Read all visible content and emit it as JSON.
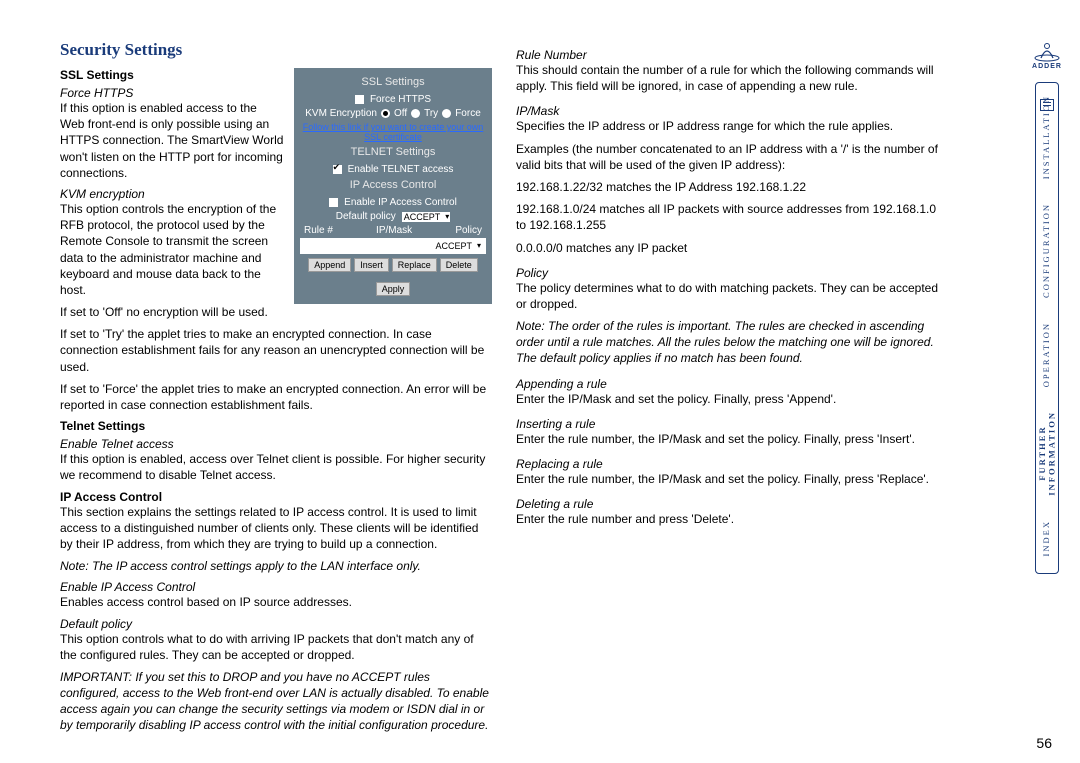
{
  "title": "Security Settings",
  "pagenum": "56",
  "left": {
    "ssl_heading": "SSL Settings",
    "force_https_h": "Force HTTPS",
    "force_https_body": "If this option is enabled access to the Web front-end is only possible using an HTTPS connection. The SmartView World won't listen on the HTTP port for incoming connections.",
    "kvm_h": "KVM encryption",
    "kvm_body1": "This option controls the encryption of the RFB protocol, the protocol used by the Remote Console to transmit the screen data to the administrator machine and keyboard and mouse data back to the host.",
    "kvm_body2": "If set to 'Off' no encryption will be used.",
    "kvm_body3": "If set to 'Try' the applet tries to make an encrypted connection. In case connection establishment fails for any reason an unencrypted connection will be used.",
    "kvm_body4": "If set to 'Force' the applet tries to make an encrypted connection. An error will be reported in case connection establishment fails.",
    "telnet_heading": "Telnet Settings",
    "telnet_h": "Enable Telnet access",
    "telnet_body": "If this option is enabled, access over Telnet client is possible. For higher security we recommend to disable Telnet access.",
    "ipac_heading": "IP Access Control",
    "ipac_body": "This section explains the settings related to IP access control. It is used to limit access to a distinguished number of clients only. These clients will be identified by their IP address, from which they are trying to build up a connection.",
    "ipac_note": "Note: The IP access control settings apply to the LAN interface only.",
    "enable_ipac_h": "Enable IP Access Control",
    "enable_ipac_body": "Enables access control based on IP source addresses.",
    "defpol_h": "Default policy",
    "defpol_body": "This option controls what to do with arriving IP packets that don't match any of the configured rules. They can be accepted or dropped.",
    "defpol_note": "IMPORTANT: If you set this to DROP and you have no ACCEPT rules configured, access to the Web front-end over LAN is actually disabled. To enable access again you can change the security settings via modem or ISDN dial in or by temporarily disabling IP access control with the initial configuration procedure."
  },
  "right": {
    "rule_h": "Rule Number",
    "rule_body": "This should contain the number of a rule for which the following commands will apply. This field will be ignored, in case of appending a new rule.",
    "ipmask_h": "IP/Mask",
    "ipmask_body": "Specifies the IP address or IP address range for which the rule applies.",
    "ipmask_ex_intro": "Examples (the number concatenated to an IP address with a '/' is the number of valid bits that will be used of the given IP address):",
    "ipmask_ex1": "192.168.1.22/32 matches the IP Address 192.168.1.22",
    "ipmask_ex2": "192.168.1.0/24 matches all IP packets with source addresses from 192.168.1.0 to 192.168.1.255",
    "ipmask_ex3": "0.0.0.0/0 matches any IP packet",
    "policy_h": "Policy",
    "policy_body": "The policy determines what to do with matching packets. They can be accepted or dropped.",
    "policy_note": "Note: The order of the rules is important. The rules are checked in ascending order until a rule matches. All the rules below the matching one will be ignored. The default policy applies if no match has been found.",
    "append_h": "Appending a rule",
    "append_body": "Enter the IP/Mask and set the policy. Finally, press 'Append'.",
    "insert_h": "Inserting a rule",
    "insert_body": "Enter the rule number, the IP/Mask and set the policy. Finally, press 'Insert'.",
    "replace_h": "Replacing a rule",
    "replace_body": "Enter the rule number, the IP/Mask and set the policy. Finally, press 'Replace'.",
    "delete_h": "Deleting a rule",
    "delete_body": "Enter the rule number and press 'Delete'."
  },
  "panel": {
    "ssl_title": "SSL Settings",
    "force_https": "Force HTTPS",
    "kvm_label": "KVM Encryption",
    "off": "Off",
    "try": "Try",
    "force": "Force",
    "ssl_link": "Follow this link if you want to create your own SSL certificate",
    "telnet_title": "TELNET Settings",
    "telnet_enable": "Enable TELNET access",
    "ipac_title": "IP Access Control",
    "ipac_enable": "Enable IP Access Control",
    "defpol_label": "Default policy",
    "accept": "ACCEPT",
    "th_rule": "Rule #",
    "th_ipmask": "IP/Mask",
    "th_policy": "Policy",
    "btn_append": "Append",
    "btn_insert": "Insert",
    "btn_replace": "Replace",
    "btn_delete": "Delete",
    "btn_apply": "Apply"
  },
  "nav": {
    "brand": "ADDER",
    "installation": "INSTALLATION",
    "configuration": "CONFIGURATION",
    "operation": "OPERATION",
    "further": "FURTHER\nINFORMATION",
    "index": "INDEX"
  }
}
